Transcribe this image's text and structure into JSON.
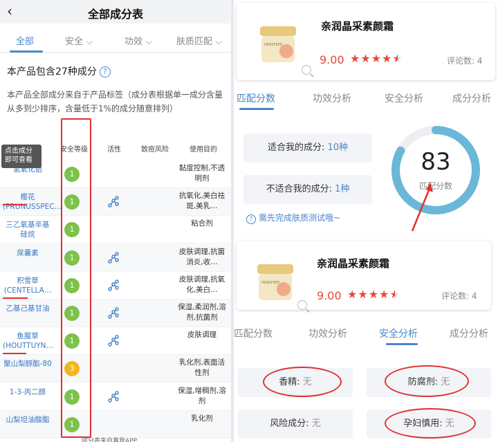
{
  "left": {
    "title": "全部成分表",
    "tabs": [
      "全部",
      "安全",
      "功效",
      "肤质匹配"
    ],
    "count_text": "本产品包含27种成分",
    "description": "本产品全部成分来自于产品标签（成分表根据单一成分含量从多到少排序，含量低于1%的成分随意排列）",
    "table_headers": [
      "安全等级",
      "活性",
      "致痘风险",
      "使用目的"
    ],
    "tooltip_line1": "点击成分",
    "tooltip_line2": "即可查看",
    "rows": [
      {
        "name": "氢氧化铝",
        "grade": "1",
        "active": false,
        "purpose": "黏度控制,不透明剂"
      },
      {
        "name": "樱花(PRUNUSSPEC…",
        "grade": "1",
        "active": true,
        "purpose": "抗氧化,美白祛斑,美乳…"
      },
      {
        "name": "三乙氧基辛基硅烷",
        "grade": "1",
        "active": false,
        "purpose": "粘合剂"
      },
      {
        "name": "尿囊素",
        "grade": "1",
        "active": true,
        "purpose": "皮肤调理,抗菌消炎,收…"
      },
      {
        "name": "积雪草(CENTELLA…",
        "grade": "1",
        "active": true,
        "purpose": "皮肤调理,抗氧化,美白…"
      },
      {
        "name": "乙基己基甘油",
        "grade": "1",
        "active": true,
        "purpose": "保湿,柔润剂,溶剂,抗菌剂"
      },
      {
        "name": "鱼腥草(HOUTTUYN…",
        "grade": "1",
        "active": true,
        "purpose": "皮肤调理"
      },
      {
        "name": "聚山梨醇酯-80",
        "grade": "3",
        "active": false,
        "purpose": "乳化剂,表面活性剂"
      },
      {
        "name": "1-3-丙二醇",
        "grade": "1",
        "active": true,
        "purpose": "保湿,增稠剂,溶剂"
      },
      {
        "name": "山梨坦油酸酯",
        "grade": "1",
        "active": false,
        "purpose": "乳化剂"
      }
    ],
    "source": "成分表来自真我APP"
  },
  "product": {
    "name": "亲润晶采素颜霜",
    "jar_label": "INNISFREE",
    "score": "9.00",
    "rating": 4.5,
    "reviews_label": "评论数: 4"
  },
  "right_tabs": [
    "匹配分数",
    "功效分析",
    "安全分析",
    "成分分析"
  ],
  "match": {
    "suitable_label": "适合我的成分:",
    "suitable_value": "10种",
    "unsuitable_label": "不适合我的成分:",
    "unsuitable_value": "1种",
    "score": "83",
    "score_label": "匹配分数",
    "score_fraction": 0.83,
    "hint": "需先完成肤质测试哦~"
  },
  "safety": {
    "fragrance": "香精:",
    "fragrance_value": "无",
    "preservative": "防腐剂:",
    "preservative_value": "无",
    "risk": "风险成分:",
    "risk_value": "无",
    "pregnancy": "孕妇慎用:",
    "pregnancy_value": "无"
  },
  "colors": {
    "accent": "#4a86c8",
    "red": "#e03030",
    "green": "#7cc24b",
    "yellow": "#f2b71f"
  }
}
